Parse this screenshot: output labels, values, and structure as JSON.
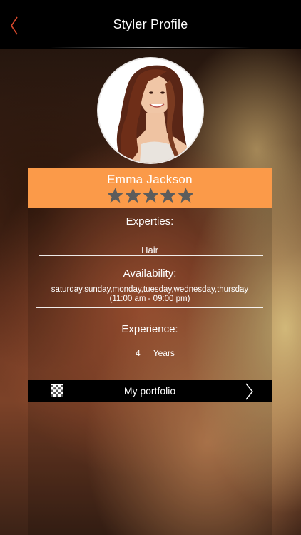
{
  "header": {
    "title": "Styler Profile",
    "back_icon": "chevron-left-icon"
  },
  "profile": {
    "name": "Emma Jackson",
    "rating": 5,
    "rating_max": 5
  },
  "expertise": {
    "label": "Experties:",
    "value": "Hair"
  },
  "availability": {
    "label": "Availability:",
    "days": "saturday,sunday,monday,tuesday,wednesday,thursday",
    "hours": "(11:00 am - 09:00 pm)"
  },
  "experience": {
    "label": "Experience:",
    "number": "4",
    "unit": "Years"
  },
  "portfolio": {
    "label": "My portfolio",
    "left_icon": "grid-icon",
    "right_icon": "chevron-right-icon"
  },
  "colors": {
    "accent": "#fb9a49",
    "nav_bg": "#000000",
    "back_arrow": "#d8492c",
    "star": "#5c5c5c"
  }
}
